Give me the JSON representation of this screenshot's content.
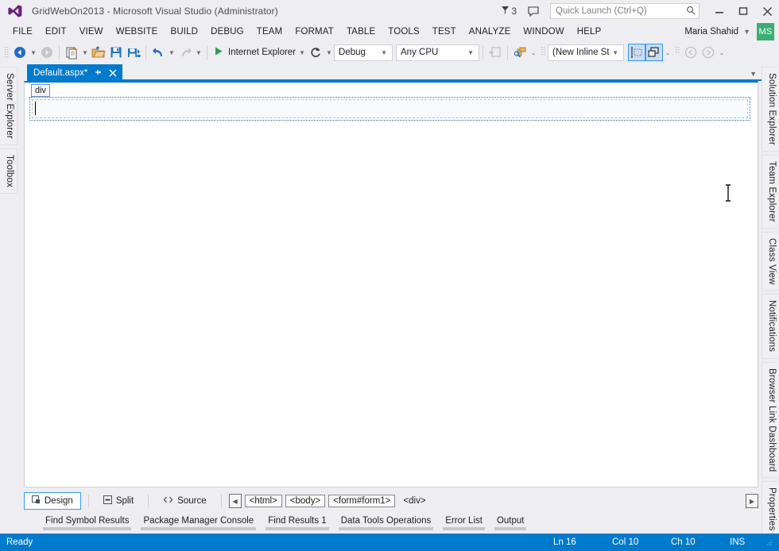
{
  "window": {
    "title": "GridWebOn2013 - Microsoft Visual Studio (Administrator)",
    "logo_icon": "visual-studio-logo",
    "notifications": {
      "icon": "flag-icon",
      "count": "3"
    },
    "feedback_icon": "feedback-speech-bubble-icon",
    "quick_launch": {
      "placeholder": "Quick Launch (Ctrl+Q)",
      "value": "",
      "icon": "search-icon"
    },
    "controls": {
      "minimize": "minimize-icon",
      "maximize": "maximize-icon",
      "close": "close-icon"
    }
  },
  "menubar": {
    "items": [
      {
        "label": "FILE"
      },
      {
        "label": "EDIT"
      },
      {
        "label": "VIEW"
      },
      {
        "label": "WEBSITE"
      },
      {
        "label": "BUILD"
      },
      {
        "label": "DEBUG"
      },
      {
        "label": "TEAM"
      },
      {
        "label": "FORMAT"
      },
      {
        "label": "TABLE"
      },
      {
        "label": "TOOLS"
      },
      {
        "label": "TEST"
      },
      {
        "label": "ANALYZE"
      },
      {
        "label": "WINDOW"
      },
      {
        "label": "HELP"
      }
    ],
    "user": {
      "name": "Maria Shahid",
      "initials": "MS",
      "avatar_color": "#3BAE73",
      "caret_icon": "chevron-down-icon"
    }
  },
  "toolbar": {
    "navigate_back_icon": "navigate-back-icon",
    "navigate_forward_icon": "navigate-forward-icon",
    "new_item_icon": "new-item-icon",
    "open_file_icon": "open-file-icon",
    "save_icon": "save-icon",
    "save_all_icon": "save-all-icon",
    "undo_icon": "undo-icon",
    "redo_icon": "redo-icon",
    "start_debug_icon": "start-play-icon",
    "start_label": "Internet Explorer",
    "refresh_icon": "refresh-icon",
    "configuration": {
      "value": "Debug",
      "caret_icon": "chevron-down-icon"
    },
    "platform": {
      "value": "Any CPU",
      "caret_icon": "chevron-down-icon"
    },
    "insert_table_icon": "insert-table-icon",
    "css_properties_icon": "css-properties-icon",
    "style_target": {
      "value": "(New Inline Style",
      "caret_icon": "chevron-down-icon"
    },
    "select_marker_icon": "select-marker-icon",
    "visual-aids_icon": "visual-aids-icon",
    "nav_back_small_icon": "circle-back-icon",
    "nav_forward_small_icon": "circle-forward-icon",
    "overflow_icon": "toolbar-overflow-icon"
  },
  "left_dock": {
    "tabs": [
      {
        "label": "Server Explorer"
      },
      {
        "label": "Toolbox"
      }
    ]
  },
  "right_dock": {
    "tabs": [
      {
        "label": "Solution Explorer"
      },
      {
        "label": "Team Explorer"
      },
      {
        "label": "Class View"
      },
      {
        "label": "Notifications"
      },
      {
        "label": "Browser Link Dashboard"
      },
      {
        "label": "Properties"
      }
    ]
  },
  "document": {
    "tab": {
      "label": "Default.aspx*",
      "pin_icon": "pin-icon",
      "close_icon": "close-icon"
    },
    "tabstrip_overflow_icon": "chevron-down-icon",
    "designer": {
      "selected_tag_badge": "div",
      "caret_visible": true,
      "mouse_cursor_icon": "i-beam-cursor"
    }
  },
  "viewbar": {
    "buttons": [
      {
        "label": "Design",
        "icon": "design-view-icon",
        "selected": true
      },
      {
        "label": "Split",
        "icon": "split-view-icon",
        "selected": false
      },
      {
        "label": "Source",
        "icon": "source-view-icon",
        "selected": false
      }
    ],
    "scroll_left_icon": "triangle-left-icon",
    "scroll_right_icon": "triangle-right-icon",
    "breadcrumb": [
      {
        "label": "<html>",
        "current": false
      },
      {
        "label": "<body>",
        "current": false
      },
      {
        "label": "<form#form1>",
        "current": false
      },
      {
        "label": "<div>",
        "current": true
      }
    ]
  },
  "tool_tabs": [
    {
      "label": "Find Symbol Results"
    },
    {
      "label": "Package Manager Console"
    },
    {
      "label": "Find Results 1"
    },
    {
      "label": "Data Tools Operations"
    },
    {
      "label": "Error List"
    },
    {
      "label": "Output"
    }
  ],
  "statusbar": {
    "state": "Ready",
    "line": "Ln 16",
    "column": "Col 10",
    "character": "Ch 10",
    "insert_mode": "INS",
    "accent_color": "#007ACC",
    "resize_grip_icon": "resize-grip-icon"
  }
}
